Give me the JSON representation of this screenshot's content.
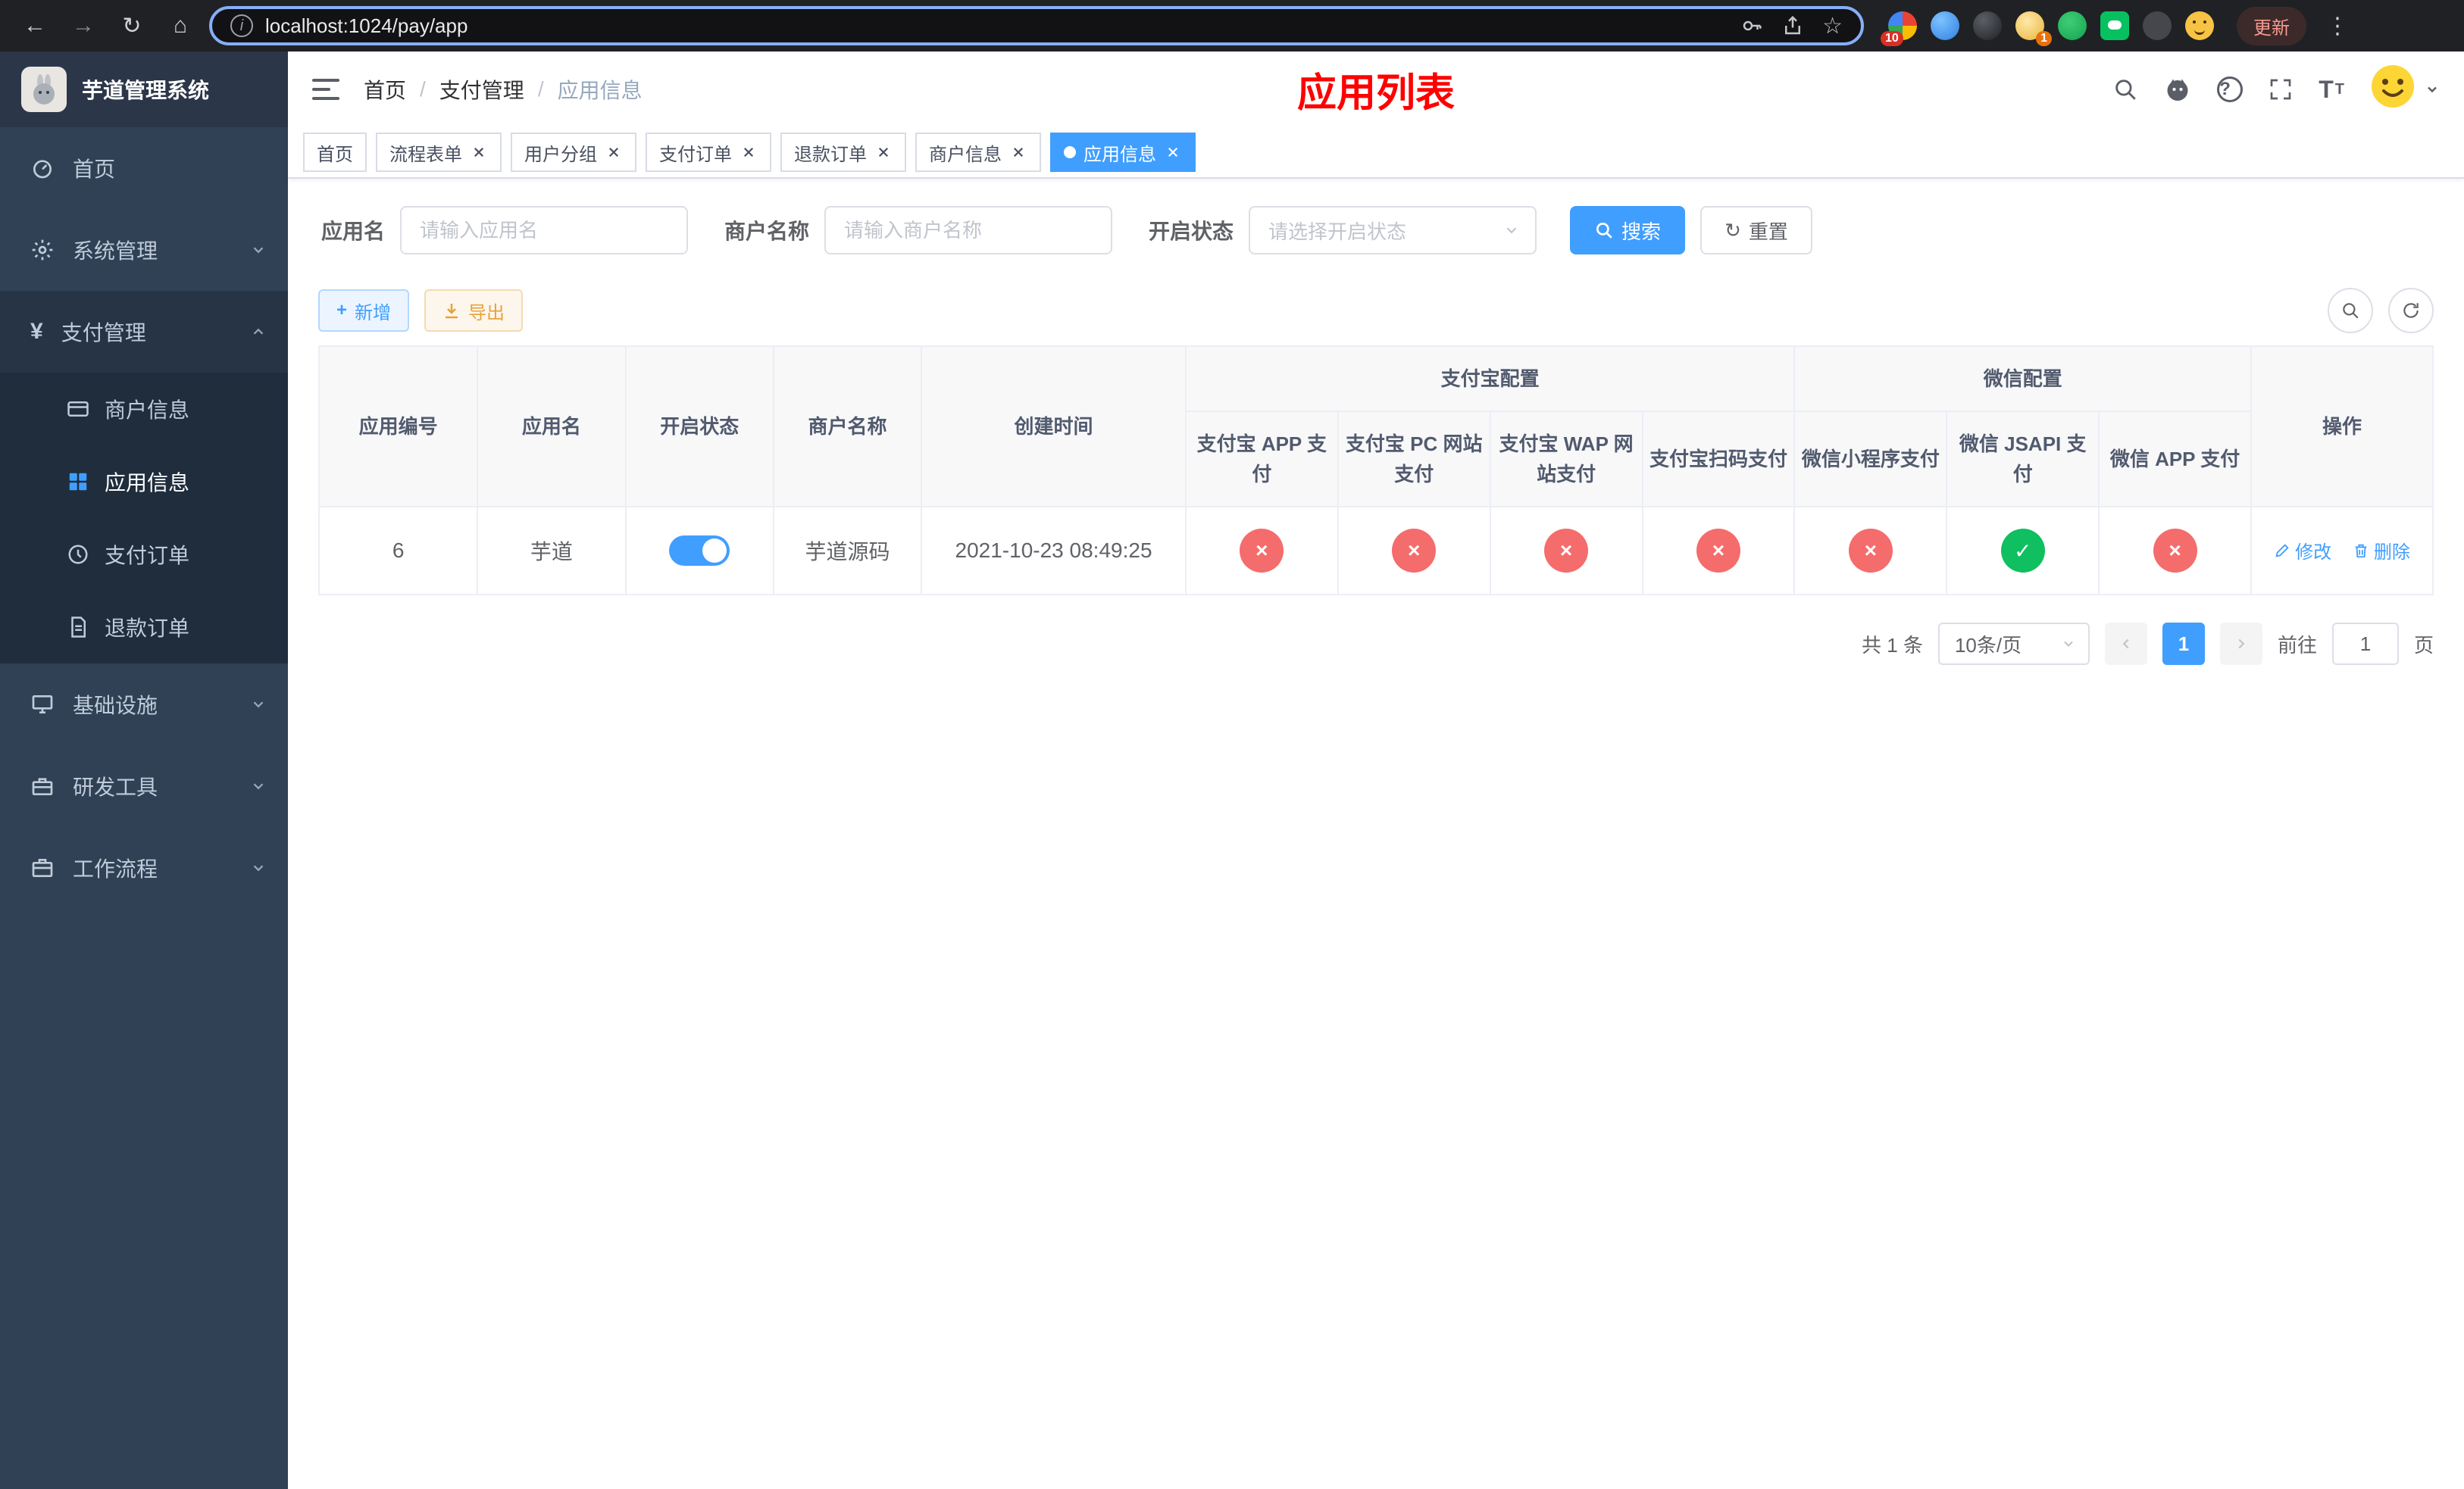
{
  "browser": {
    "url": "localhost:1024/pay/app",
    "update_button": "更新",
    "extension_badges": {
      "first": "10",
      "second": "1"
    }
  },
  "sidebar": {
    "title": "芋道管理系统",
    "menu": [
      {
        "label": "首页"
      },
      {
        "label": "系统管理",
        "expanded": false
      },
      {
        "label": "支付管理",
        "expanded": true
      },
      {
        "label": "商户信息"
      },
      {
        "label": "应用信息",
        "active": true
      },
      {
        "label": "支付订单"
      },
      {
        "label": "退款订单"
      },
      {
        "label": "基础设施",
        "expanded": false
      },
      {
        "label": "研发工具",
        "expanded": false
      },
      {
        "label": "工作流程",
        "expanded": false
      }
    ]
  },
  "header": {
    "breadcrumb": [
      "首页",
      "支付管理",
      "应用信息"
    ],
    "breadcrumb_separator": "/",
    "page_title": "应用列表"
  },
  "tabs": [
    {
      "label": "首页",
      "active": false,
      "closable": false
    },
    {
      "label": "流程表单",
      "active": false,
      "closable": true
    },
    {
      "label": "用户分组",
      "active": false,
      "closable": true
    },
    {
      "label": "支付订单",
      "active": false,
      "closable": true
    },
    {
      "label": "退款订单",
      "active": false,
      "closable": true
    },
    {
      "label": "商户信息",
      "active": false,
      "closable": true
    },
    {
      "label": "应用信息",
      "active": true,
      "closable": true
    }
  ],
  "filters": {
    "app_name_label": "应用名",
    "app_name_placeholder": "请输入应用名",
    "merchant_label": "商户名称",
    "merchant_placeholder": "请输入商户名称",
    "status_label": "开启状态",
    "status_placeholder": "请选择开启状态",
    "search_button": "搜索",
    "reset_button": "重置"
  },
  "toolbar": {
    "add_button": "新增",
    "export_button": "导出"
  },
  "table": {
    "group_headers": {
      "alipay": "支付宝配置",
      "wechat": "微信配置"
    },
    "columns": [
      "应用编号",
      "应用名",
      "开启状态",
      "商户名称",
      "创建时间",
      "支付宝 APP 支付",
      "支付宝 PC 网站支付",
      "支付宝 WAP 网站支付",
      "支付宝扫码支付",
      "微信小程序支付",
      "微信 JSAPI 支付",
      "微信 APP 支付",
      "操作"
    ],
    "status_glyphs": {
      "on": "✓",
      "off": "×"
    },
    "row": {
      "id": "6",
      "name": "芋道",
      "enabled": true,
      "merchant": "芋道源码",
      "created": "2021-10-23 08:49:25",
      "config": {
        "alipay_app": false,
        "alipay_pc": false,
        "alipay_wap": false,
        "alipay_qr": false,
        "wx_mini": false,
        "wx_jsapi": true,
        "wx_app": false
      },
      "ops": {
        "edit": "修改",
        "delete": "删除"
      }
    }
  },
  "pagination": {
    "total": "共 1 条",
    "page_size": "10条/页",
    "current_page": "1",
    "jump_prefix": "前往",
    "jump_suffix": "页",
    "jump_value": "1"
  },
  "colors": {
    "accent": "#409eff",
    "danger": "#f56c6c",
    "success": "#0fbf60",
    "title-red": "#ff0000"
  }
}
